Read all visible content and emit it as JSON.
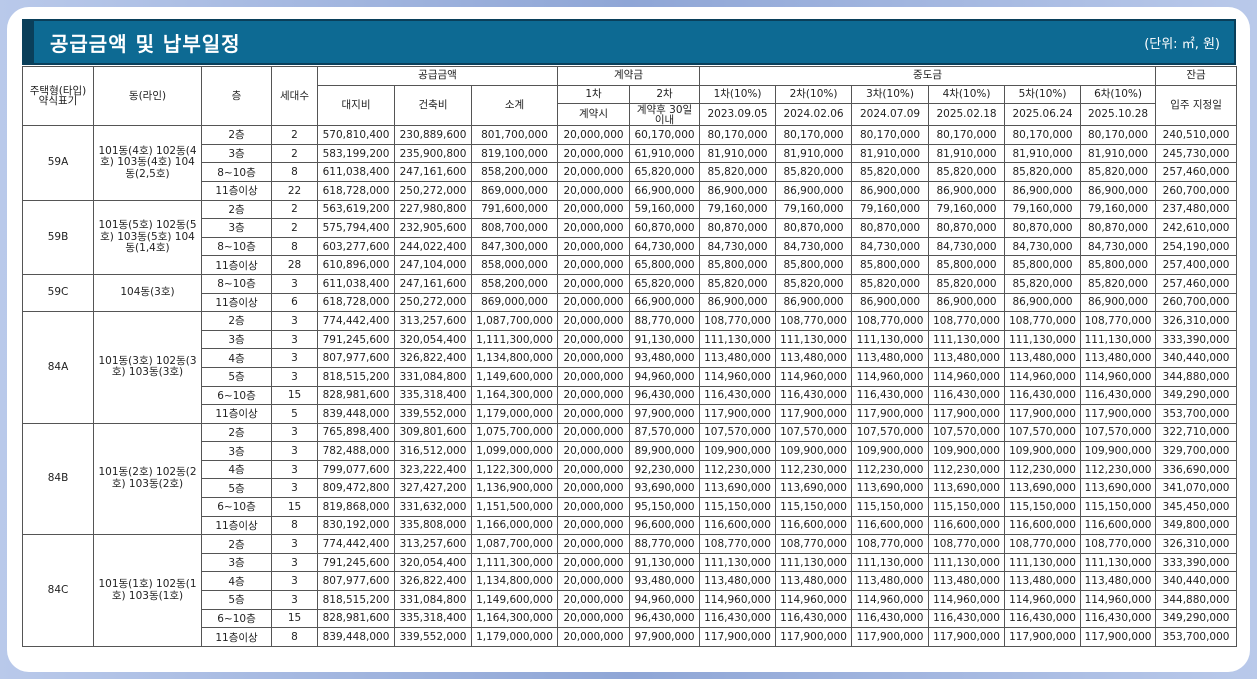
{
  "title": "공급금액 및 납부일정",
  "unit": "(단위: ㎡, 원)",
  "headers": {
    "type": "주택형(타입) 약식표기",
    "dong": "동(라인)",
    "floor": "층",
    "units": "세대수",
    "supply": "공급금액",
    "land": "대지비",
    "building": "건축비",
    "subtotal": "소계",
    "deposit": "계약금",
    "dep1": "1차",
    "dep2": "2차",
    "dep1_when": "계약시",
    "dep2_when": "계약후 30일 이내",
    "middle": "중도금",
    "mid": [
      "1차(10%)",
      "2차(10%)",
      "3차(10%)",
      "4차(10%)",
      "5차(10%)",
      "6차(10%)"
    ],
    "mid_dates": [
      "2023.09.05",
      "2024.02.06",
      "2024.07.09",
      "2025.02.18",
      "2025.06.24",
      "2025.10.28"
    ],
    "balance": "잔금",
    "balance_when": "입주 지정일"
  },
  "groups": [
    {
      "type": "59A",
      "dong": "101동(4호) 102동(4호) 103동(4호) 104동(2,5호)",
      "rows": [
        [
          "2층",
          "2",
          "570,810,400",
          "230,889,600",
          "801,700,000",
          "20,000,000",
          "60,170,000",
          "80,170,000",
          "80,170,000",
          "80,170,000",
          "80,170,000",
          "80,170,000",
          "80,170,000",
          "240,510,000"
        ],
        [
          "3층",
          "2",
          "583,199,200",
          "235,900,800",
          "819,100,000",
          "20,000,000",
          "61,910,000",
          "81,910,000",
          "81,910,000",
          "81,910,000",
          "81,910,000",
          "81,910,000",
          "81,910,000",
          "245,730,000"
        ],
        [
          "8~10층",
          "8",
          "611,038,400",
          "247,161,600",
          "858,200,000",
          "20,000,000",
          "65,820,000",
          "85,820,000",
          "85,820,000",
          "85,820,000",
          "85,820,000",
          "85,820,000",
          "85,820,000",
          "257,460,000"
        ],
        [
          "11층이상",
          "22",
          "618,728,000",
          "250,272,000",
          "869,000,000",
          "20,000,000",
          "66,900,000",
          "86,900,000",
          "86,900,000",
          "86,900,000",
          "86,900,000",
          "86,900,000",
          "86,900,000",
          "260,700,000"
        ]
      ]
    },
    {
      "type": "59B",
      "dong": "101동(5호) 102동(5호) 103동(5호) 104동(1,4호)",
      "rows": [
        [
          "2층",
          "2",
          "563,619,200",
          "227,980,800",
          "791,600,000",
          "20,000,000",
          "59,160,000",
          "79,160,000",
          "79,160,000",
          "79,160,000",
          "79,160,000",
          "79,160,000",
          "79,160,000",
          "237,480,000"
        ],
        [
          "3층",
          "2",
          "575,794,400",
          "232,905,600",
          "808,700,000",
          "20,000,000",
          "60,870,000",
          "80,870,000",
          "80,870,000",
          "80,870,000",
          "80,870,000",
          "80,870,000",
          "80,870,000",
          "242,610,000"
        ],
        [
          "8~10층",
          "8",
          "603,277,600",
          "244,022,400",
          "847,300,000",
          "20,000,000",
          "64,730,000",
          "84,730,000",
          "84,730,000",
          "84,730,000",
          "84,730,000",
          "84,730,000",
          "84,730,000",
          "254,190,000"
        ],
        [
          "11층이상",
          "28",
          "610,896,000",
          "247,104,000",
          "858,000,000",
          "20,000,000",
          "65,800,000",
          "85,800,000",
          "85,800,000",
          "85,800,000",
          "85,800,000",
          "85,800,000",
          "85,800,000",
          "257,400,000"
        ]
      ]
    },
    {
      "type": "59C",
      "dong": "104동(3호)",
      "rows": [
        [
          "8~10층",
          "3",
          "611,038,400",
          "247,161,600",
          "858,200,000",
          "20,000,000",
          "65,820,000",
          "85,820,000",
          "85,820,000",
          "85,820,000",
          "85,820,000",
          "85,820,000",
          "85,820,000",
          "257,460,000"
        ],
        [
          "11층이상",
          "6",
          "618,728,000",
          "250,272,000",
          "869,000,000",
          "20,000,000",
          "66,900,000",
          "86,900,000",
          "86,900,000",
          "86,900,000",
          "86,900,000",
          "86,900,000",
          "86,900,000",
          "260,700,000"
        ]
      ]
    },
    {
      "type": "84A",
      "dong": "101동(3호) 102동(3호) 103동(3호)",
      "rows": [
        [
          "2층",
          "3",
          "774,442,400",
          "313,257,600",
          "1,087,700,000",
          "20,000,000",
          "88,770,000",
          "108,770,000",
          "108,770,000",
          "108,770,000",
          "108,770,000",
          "108,770,000",
          "108,770,000",
          "326,310,000"
        ],
        [
          "3층",
          "3",
          "791,245,600",
          "320,054,400",
          "1,111,300,000",
          "20,000,000",
          "91,130,000",
          "111,130,000",
          "111,130,000",
          "111,130,000",
          "111,130,000",
          "111,130,000",
          "111,130,000",
          "333,390,000"
        ],
        [
          "4층",
          "3",
          "807,977,600",
          "326,822,400",
          "1,134,800,000",
          "20,000,000",
          "93,480,000",
          "113,480,000",
          "113,480,000",
          "113,480,000",
          "113,480,000",
          "113,480,000",
          "113,480,000",
          "340,440,000"
        ],
        [
          "5층",
          "3",
          "818,515,200",
          "331,084,800",
          "1,149,600,000",
          "20,000,000",
          "94,960,000",
          "114,960,000",
          "114,960,000",
          "114,960,000",
          "114,960,000",
          "114,960,000",
          "114,960,000",
          "344,880,000"
        ],
        [
          "6~10층",
          "15",
          "828,981,600",
          "335,318,400",
          "1,164,300,000",
          "20,000,000",
          "96,430,000",
          "116,430,000",
          "116,430,000",
          "116,430,000",
          "116,430,000",
          "116,430,000",
          "116,430,000",
          "349,290,000"
        ],
        [
          "11층이상",
          "5",
          "839,448,000",
          "339,552,000",
          "1,179,000,000",
          "20,000,000",
          "97,900,000",
          "117,900,000",
          "117,900,000",
          "117,900,000",
          "117,900,000",
          "117,900,000",
          "117,900,000",
          "353,700,000"
        ]
      ]
    },
    {
      "type": "84B",
      "dong": "101동(2호) 102동(2호) 103동(2호)",
      "rows": [
        [
          "2층",
          "3",
          "765,898,400",
          "309,801,600",
          "1,075,700,000",
          "20,000,000",
          "87,570,000",
          "107,570,000",
          "107,570,000",
          "107,570,000",
          "107,570,000",
          "107,570,000",
          "107,570,000",
          "322,710,000"
        ],
        [
          "3층",
          "3",
          "782,488,000",
          "316,512,000",
          "1,099,000,000",
          "20,000,000",
          "89,900,000",
          "109,900,000",
          "109,900,000",
          "109,900,000",
          "109,900,000",
          "109,900,000",
          "109,900,000",
          "329,700,000"
        ],
        [
          "4층",
          "3",
          "799,077,600",
          "323,222,400",
          "1,122,300,000",
          "20,000,000",
          "92,230,000",
          "112,230,000",
          "112,230,000",
          "112,230,000",
          "112,230,000",
          "112,230,000",
          "112,230,000",
          "336,690,000"
        ],
        [
          "5층",
          "3",
          "809,472,800",
          "327,427,200",
          "1,136,900,000",
          "20,000,000",
          "93,690,000",
          "113,690,000",
          "113,690,000",
          "113,690,000",
          "113,690,000",
          "113,690,000",
          "113,690,000",
          "341,070,000"
        ],
        [
          "6~10층",
          "15",
          "819,868,000",
          "331,632,000",
          "1,151,500,000",
          "20,000,000",
          "95,150,000",
          "115,150,000",
          "115,150,000",
          "115,150,000",
          "115,150,000",
          "115,150,000",
          "115,150,000",
          "345,450,000"
        ],
        [
          "11층이상",
          "8",
          "830,192,000",
          "335,808,000",
          "1,166,000,000",
          "20,000,000",
          "96,600,000",
          "116,600,000",
          "116,600,000",
          "116,600,000",
          "116,600,000",
          "116,600,000",
          "116,600,000",
          "349,800,000"
        ]
      ]
    },
    {
      "type": "84C",
      "dong": "101동(1호) 102동(1호) 103동(1호)",
      "rows": [
        [
          "2층",
          "3",
          "774,442,400",
          "313,257,600",
          "1,087,700,000",
          "20,000,000",
          "88,770,000",
          "108,770,000",
          "108,770,000",
          "108,770,000",
          "108,770,000",
          "108,770,000",
          "108,770,000",
          "326,310,000"
        ],
        [
          "3층",
          "3",
          "791,245,600",
          "320,054,400",
          "1,111,300,000",
          "20,000,000",
          "91,130,000",
          "111,130,000",
          "111,130,000",
          "111,130,000",
          "111,130,000",
          "111,130,000",
          "111,130,000",
          "333,390,000"
        ],
        [
          "4층",
          "3",
          "807,977,600",
          "326,822,400",
          "1,134,800,000",
          "20,000,000",
          "93,480,000",
          "113,480,000",
          "113,480,000",
          "113,480,000",
          "113,480,000",
          "113,480,000",
          "113,480,000",
          "340,440,000"
        ],
        [
          "5층",
          "3",
          "818,515,200",
          "331,084,800",
          "1,149,600,000",
          "20,000,000",
          "94,960,000",
          "114,960,000",
          "114,960,000",
          "114,960,000",
          "114,960,000",
          "114,960,000",
          "114,960,000",
          "344,880,000"
        ],
        [
          "6~10층",
          "15",
          "828,981,600",
          "335,318,400",
          "1,164,300,000",
          "20,000,000",
          "96,430,000",
          "116,430,000",
          "116,430,000",
          "116,430,000",
          "116,430,000",
          "116,430,000",
          "116,430,000",
          "349,290,000"
        ],
        [
          "11층이상",
          "8",
          "839,448,000",
          "339,552,000",
          "1,179,000,000",
          "20,000,000",
          "97,900,000",
          "117,900,000",
          "117,900,000",
          "117,900,000",
          "117,900,000",
          "117,900,000",
          "117,900,000",
          "353,700,000"
        ]
      ]
    }
  ]
}
